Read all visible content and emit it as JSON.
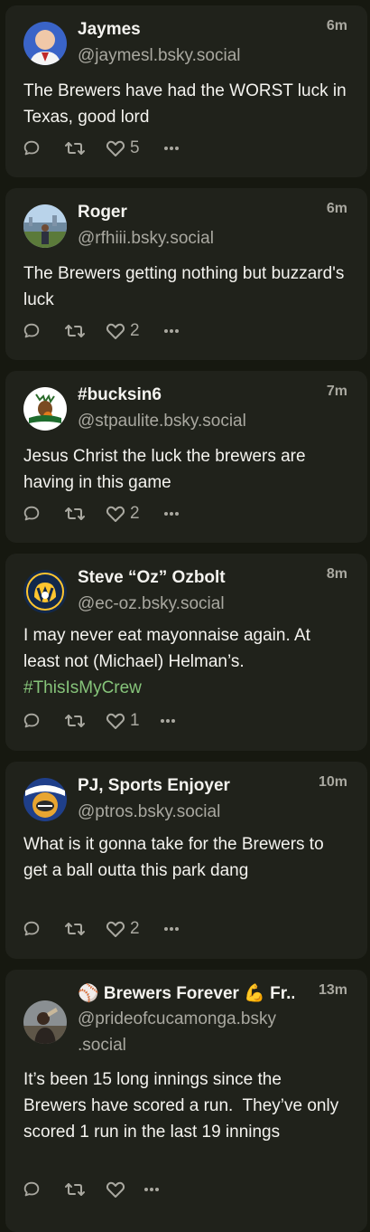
{
  "posts": [
    {
      "name": "Jaymes",
      "handle": "@jaymesl.bsky.social",
      "time": "6m",
      "text": "The Brewers have had the WORST luck in Texas, good lord",
      "likes": "5",
      "avatar_icon": "avatar-jaymes-icon"
    },
    {
      "name": "Roger",
      "handle": "@rfhiii.bsky.social",
      "time": "6m",
      "text": "The Brewers getting nothing but buzzard's luck",
      "likes": "2",
      "avatar_icon": "avatar-roger-icon"
    },
    {
      "name": "#bucksin6",
      "handle": "@stpaulite.bsky.social",
      "time": "7m",
      "text": "Jesus Christ the luck the brewers are having in this game",
      "likes": "2",
      "avatar_icon": "avatar-milwaukee-bucks-icon"
    },
    {
      "name": "Steve “Oz” Ozbolt",
      "handle": "@ec-oz.bsky.social",
      "time": "8m",
      "text": "I may never eat mayonnaise again. At least not (Michael) Helman’s. ",
      "hashtag": "#ThisIsMyCrew",
      "likes": "1",
      "avatar_icon": "avatar-brewers-glove-logo-icon"
    },
    {
      "name": "PJ, Sports Enjoyer",
      "handle": "@ptros.bsky.social",
      "time": "10m",
      "text": "What is it gonna take for the Brewers to get a ball outta this park dang",
      "likes": "2",
      "avatar_icon": "avatar-forward-badger-icon"
    },
    {
      "name": "⚾ Brewers Forever 💪 Fr...",
      "handle": "@prideofcucamonga.bsky .social",
      "time": "13m",
      "text": "It’s been 15 long innings since the Brewers have scored a run.  They’ve only scored 1 run in the last 19 innings",
      "likes": "",
      "avatar_icon": "avatar-brewers-forever-icon"
    }
  ],
  "colors": {
    "background": "#161810",
    "card": "#20221b",
    "text": "#f4f3ef",
    "muted": "#a9a8a0",
    "hashtag": "#86c47a"
  },
  "action_icons": [
    "reply-icon",
    "repost-icon",
    "like-icon",
    "more-icon"
  ]
}
